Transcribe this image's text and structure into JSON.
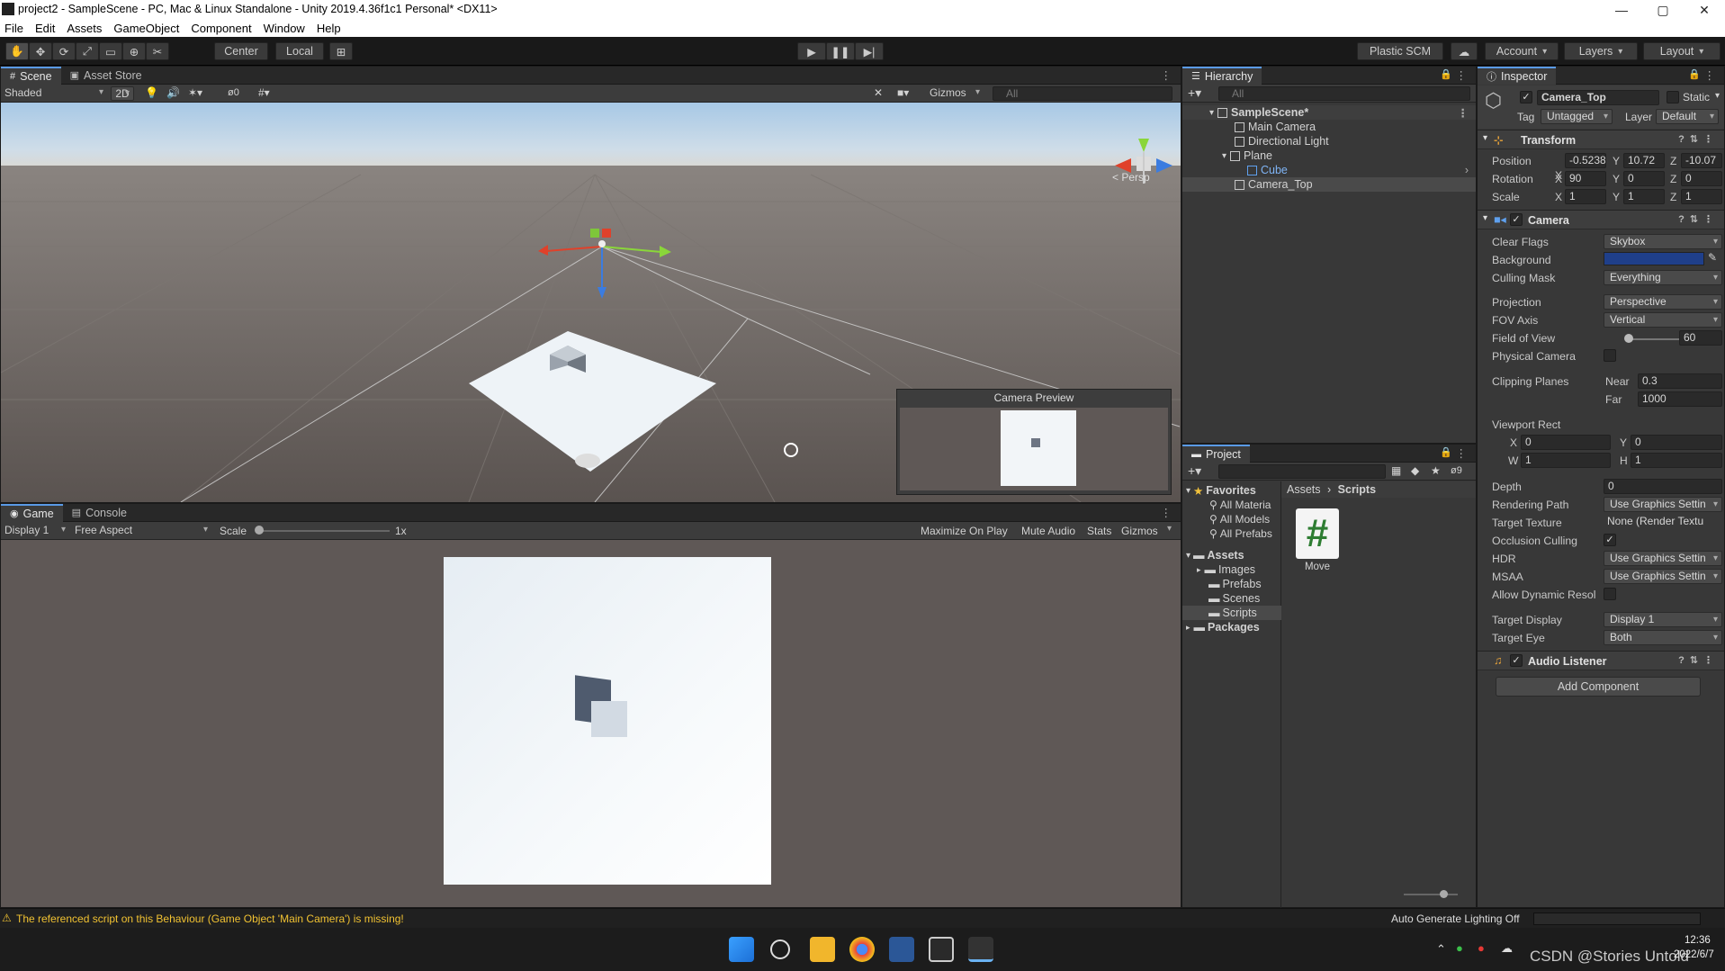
{
  "window": {
    "title": "project2 - SampleScene - PC, Mac & Linux Standalone - Unity 2019.4.36f1c1 Personal* <DX11>",
    "controls": [
      "—",
      "▢",
      "✕"
    ]
  },
  "menu": [
    "File",
    "Edit",
    "Assets",
    "GameObject",
    "Component",
    "Window",
    "Help"
  ],
  "toolbar": {
    "pivot": "Center",
    "space": "Local",
    "plastic": "Plastic SCM",
    "account": "Account",
    "layers": "Layers",
    "layout": "Layout"
  },
  "scene": {
    "tabs": [
      "Scene",
      "Asset Store"
    ],
    "shading": "Shaded",
    "mode2d": "2D",
    "hidden_count": "0",
    "gizmos": "Gizmos",
    "search_placeholder": "All",
    "persp_label": "Persp",
    "camera_preview_title": "Camera Preview"
  },
  "game": {
    "tabs": [
      "Game",
      "Console"
    ],
    "display": "Display 1",
    "aspect": "Free Aspect",
    "scale_label": "Scale",
    "scale_value": "1x",
    "buttons": [
      "Maximize On Play",
      "Mute Audio",
      "Stats",
      "Gizmos"
    ]
  },
  "hierarchy": {
    "title": "Hierarchy",
    "search_placeholder": "All",
    "scene": "SampleScene*",
    "items": [
      {
        "label": "Main Camera",
        "depth": 1
      },
      {
        "label": "Directional Light",
        "depth": 1
      },
      {
        "label": "Plane",
        "depth": 1
      },
      {
        "label": "Cube",
        "depth": 2
      },
      {
        "label": "Camera_Top",
        "depth": 1
      }
    ]
  },
  "project": {
    "title": "Project",
    "hidden_count": "9",
    "favorites": "Favorites",
    "favorite_items": [
      "All Materia",
      "All Models",
      "All Prefabs"
    ],
    "assets": "Assets",
    "asset_folders": [
      "Images",
      "Prefabs",
      "Scenes",
      "Scripts"
    ],
    "packages": "Packages",
    "breadcrumb": [
      "Assets",
      "Scripts"
    ],
    "files": [
      {
        "name": "Move",
        "glyph": "#"
      }
    ]
  },
  "inspector": {
    "title": "Inspector",
    "object_name": "Camera_Top",
    "static_label": "Static",
    "tag_label": "Tag",
    "tag": "Untagged",
    "layer_label": "Layer",
    "layer": "Default",
    "transform": {
      "title": "Transform",
      "position_label": "Position",
      "rotation_label": "Rotation",
      "scale_label": "Scale",
      "position": [
        "-0.5238",
        "10.72",
        "-10.07"
      ],
      "rotation": [
        "90",
        "0",
        "0"
      ],
      "scale": [
        "1",
        "1",
        "1"
      ]
    },
    "camera": {
      "title": "Camera",
      "clear_flags_label": "Clear Flags",
      "clear_flags": "Skybox",
      "background_label": "Background",
      "background_color": "#1f3f8a",
      "culling_mask_label": "Culling Mask",
      "culling_mask": "Everything",
      "projection_label": "Projection",
      "projection": "Perspective",
      "fov_axis_label": "FOV Axis",
      "fov_axis": "Vertical",
      "fov_label": "Field of View",
      "fov": "60",
      "physical_label": "Physical Camera",
      "clipping_label": "Clipping Planes",
      "near_label": "Near",
      "near": "0.3",
      "far_label": "Far",
      "far": "1000",
      "viewport_label": "Viewport Rect",
      "vx": "0",
      "vy": "0",
      "vw": "1",
      "vh": "1",
      "depth_label": "Depth",
      "depth": "0",
      "rendering_path_label": "Rendering Path",
      "rendering_path": "Use Graphics Settin",
      "target_texture_label": "Target Texture",
      "target_texture": "None (Render Textu",
      "occlusion_label": "Occlusion Culling",
      "hdr_label": "HDR",
      "hdr": "Use Graphics Settin",
      "msaa_label": "MSAA",
      "msaa": "Use Graphics Settin",
      "dynres_label": "Allow Dynamic Resol",
      "target_display_label": "Target Display",
      "target_display": "Display 1",
      "target_eye_label": "Target Eye",
      "target_eye": "Both"
    },
    "audio_listener": "Audio Listener",
    "add_component": "Add Component"
  },
  "status": {
    "warning": "The referenced script on this Behaviour (Game Object 'Main Camera') is missing!",
    "lighting": "Auto Generate Lighting Off"
  },
  "taskbar": {
    "time": "12:36",
    "date": "2022/6/7",
    "watermark": "CSDN @Stories Untold"
  }
}
